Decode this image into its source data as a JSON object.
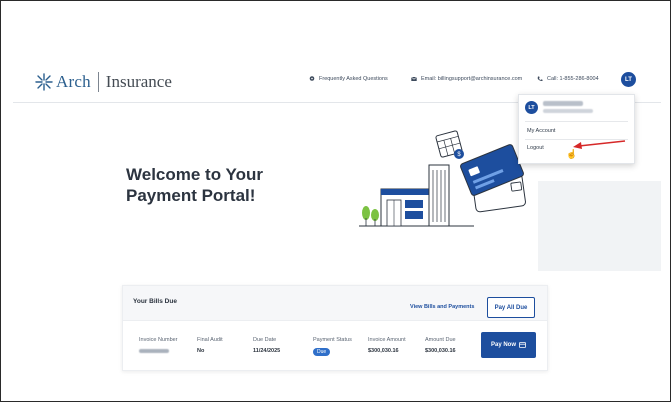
{
  "brand": {
    "name_part1": "Arch",
    "name_part2": "Insurance"
  },
  "topnav": {
    "faq": "Frequently Asked Questions",
    "email": "Email: billingsupport@archinsurance.com",
    "call": "Call: 1-855-286-8004"
  },
  "user": {
    "initials": "LT"
  },
  "dropdown": {
    "my_account": "My Account",
    "logout": "Logout"
  },
  "hero": {
    "title_line1": "Welcome to Your",
    "title_line2": "Payment Portal!"
  },
  "bills": {
    "title": "Your Bills Due",
    "view_link": "View Bills and Payments",
    "pay_all": "Pay All Due",
    "columns": {
      "invoice_number": "Invoice Number",
      "final_audit": "Final Audit",
      "due_date": "Due Date",
      "payment_status": "Payment Status",
      "invoice_amount": "Invoice Amount",
      "amount_due": "Amount Due"
    },
    "row": {
      "final_audit": "No",
      "due_date": "11/24/2025",
      "status": "Due",
      "invoice_amount": "$300,030.16",
      "amount_due": "$300,030.16"
    },
    "pay_now": "Pay Now"
  },
  "colors": {
    "primary": "#1d4e9e",
    "accent_red": "#d62828"
  }
}
